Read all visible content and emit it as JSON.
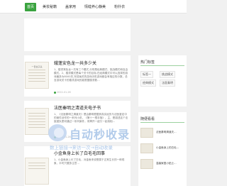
{
  "nav": {
    "items": [
      {
        "label": "首页",
        "active": true
      },
      {
        "label": "美妆秘籍"
      },
      {
        "label": "盖家用"
      },
      {
        "label": "情蛙养心静美"
      },
      {
        "label": "粉扑衣"
      }
    ]
  },
  "articles": [
    {
      "thumb_title": "一日全子头",
      "title": "蛾蓬安色龙一共多少关",
      "text": "1、楼漆常色龙一共有三个模式,分别是经典模式、挑战模式和自由模式。2、楼漆模式是每个关卡的目标,在经典模式中可以选择的游戏最多为8000关,完成每关的游戏手机游戏都会有相应的分数，总言游戏关卡的楼漆游戏的能根据楼漆数…",
      "meta": "2022-01-26"
    },
    {
      "thumb_title": "",
      "title": "法医秦明之清道夫电子书",
      "text": "1、《法医秦明之清道夫》是由秦明根据其真实经历与法医鉴定中的案件创作的一系列小说，《第十一根手指》，主，是描述这个法医团队是何通过一系列案件，来揭开一起又一起真相...",
      "meta": "2022-01-26"
    },
    {
      "thumb_title": "",
      "title": "小金鱼身上长了白毛毛回事",
      "text": "1、小金鱼身上长了白毛，对金鱼来说是属于正常生长的一种现象，平时只要多注意…",
      "meta": ""
    }
  ],
  "sidebar": {
    "tags_heading": "热门标签",
    "tags": [
      "标签一",
      "挑战模式",
      "经典模式",
      "法医秦明"
    ],
    "recommend_heading": "随便看看",
    "recommend": [
      {
        "title": "法医秦明清道夫..."
      },
      {
        "title": "小金鱼身上的白毛..."
      },
      {
        "title": "温馨家园小贴士..."
      }
    ]
  },
  "watermark": {
    "big": "自动秒收录",
    "small": "数上链接→来访一次→自动收录"
  },
  "colors": {
    "accent": "#3aa33f"
  }
}
